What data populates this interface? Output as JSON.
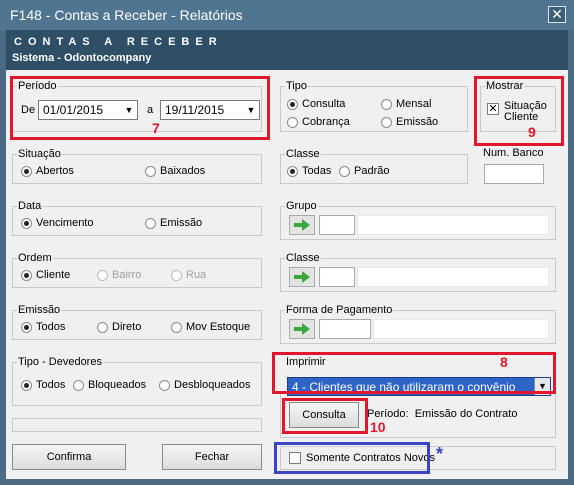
{
  "window": {
    "title": "F148 - Contas a Receber - Relatórios",
    "close": "✕"
  },
  "header": {
    "title": "CONTAS A RECEBER",
    "subtitle": "Sistema - Odontocompany"
  },
  "periodo": {
    "legend": "Período",
    "de_label": "De",
    "de_value": "01/01/2015",
    "a_label": "a",
    "a_value": "19/11/2015"
  },
  "tipo": {
    "legend": "Tipo",
    "options": [
      "Consulta",
      "Mensal",
      "Cobrança",
      "Emissão"
    ],
    "selected": "Consulta"
  },
  "mostrar": {
    "legend": "Mostrar",
    "checkbox_label_1": "Situação",
    "checkbox_label_2": "Cliente"
  },
  "situacao": {
    "legend": "Situação",
    "options": [
      "Abertos",
      "Baixados"
    ]
  },
  "classe1": {
    "legend": "Classe",
    "options": [
      "Todas",
      "Padrão"
    ]
  },
  "num_banco": {
    "legend": "Num. Banco"
  },
  "data": {
    "legend": "Data",
    "options": [
      "Vencimento",
      "Emissão"
    ]
  },
  "grupo": {
    "legend": "Grupo"
  },
  "ordem": {
    "legend": "Ordem",
    "options": [
      "Cliente",
      "Bairro",
      "Rua"
    ]
  },
  "classe2": {
    "legend": "Classe"
  },
  "emissao": {
    "legend": "Emissão",
    "options": [
      "Todos",
      "Direto",
      "Mov Estoque"
    ]
  },
  "forma_pagamento": {
    "legend": "Forma de Pagamento"
  },
  "tipo_devedores": {
    "legend": "Tipo - Devedores",
    "options": [
      "Todos",
      "Bloqueados",
      "Desbloqueados"
    ]
  },
  "imprimir": {
    "legend": "Imprimir",
    "value": "4 - Clientes que não utilizaram o convênio"
  },
  "consulta": {
    "button": "Consulta",
    "periodo_label": "Período:",
    "periodo_value": "Emissão do Contrato"
  },
  "footer": {
    "confirma": "Confirma",
    "fechar": "Fechar",
    "somente_label": "Somente Contratos Novos"
  },
  "annotations": {
    "n7": "7",
    "n8": "8",
    "n9": "9",
    "n10": "10",
    "star": "*"
  },
  "colors": {
    "highlight_red": "#e2162c",
    "highlight_blue": "#3a44c4",
    "selection": "#2e64c8"
  }
}
